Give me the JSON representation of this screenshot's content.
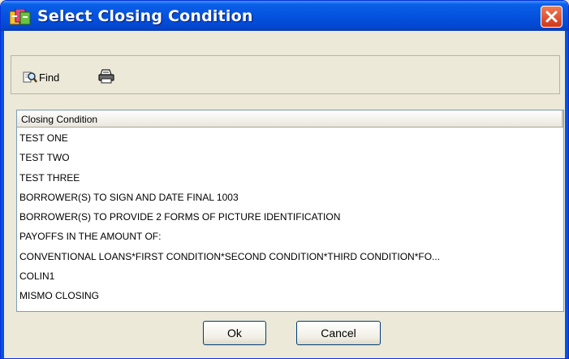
{
  "window": {
    "title": "Select Closing Condition",
    "icon": "app-icon",
    "close_icon": "close-icon"
  },
  "toolbar": {
    "find_label": "Find",
    "find_icon": "find-icon",
    "print_icon": "printer-icon"
  },
  "table": {
    "column_header": "Closing Condition",
    "rows": [
      "TEST ONE",
      "TEST TWO",
      "TEST THREE",
      "BORROWER(S) TO SIGN AND DATE FINAL 1003",
      "BORROWER(S) TO PROVIDE 2 FORMS OF PICTURE IDENTIFICATION",
      "PAYOFFS IN THE AMOUNT OF:",
      "CONVENTIONAL LOANS*FIRST CONDITION*SECOND CONDITION*THIRD CONDITION*FO...",
      "COLIN1",
      "MISMO CLOSING"
    ]
  },
  "buttons": {
    "ok_label": "Ok",
    "cancel_label": "Cancel"
  },
  "colors": {
    "titlebar": "#0453de",
    "close": "#d0381a",
    "panel": "#ece9d8"
  }
}
